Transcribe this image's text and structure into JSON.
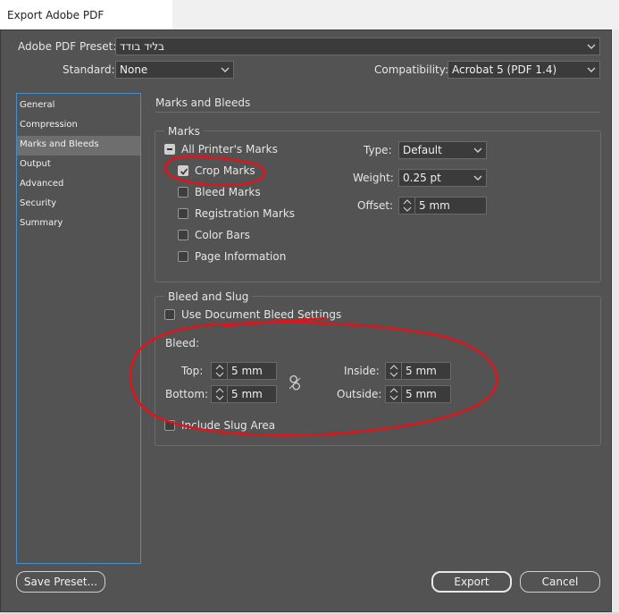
{
  "window": {
    "title": "Export Adobe PDF"
  },
  "preset": {
    "label": "Adobe PDF Preset:",
    "value": "בליד בודד"
  },
  "standard": {
    "label": "Standard:",
    "value": "None"
  },
  "compatibility": {
    "label": "Compatibility:",
    "value": "Acrobat 5 (PDF 1.4)"
  },
  "sidebar": {
    "items": [
      {
        "label": "General"
      },
      {
        "label": "Compression"
      },
      {
        "label": "Marks and Bleeds"
      },
      {
        "label": "Output"
      },
      {
        "label": "Advanced"
      },
      {
        "label": "Security"
      },
      {
        "label": "Summary"
      }
    ],
    "selected_index": 2
  },
  "panel": {
    "title": "Marks and Bleeds"
  },
  "marks": {
    "group_title": "Marks",
    "all_printers_marks": "All Printer's Marks",
    "crop_marks": "Crop Marks",
    "bleed_marks": "Bleed Marks",
    "registration_marks": "Registration Marks",
    "color_bars": "Color Bars",
    "page_information": "Page Information",
    "type_label": "Type:",
    "type_value": "Default",
    "weight_label": "Weight:",
    "weight_value": "0.25 pt",
    "offset_label": "Offset:",
    "offset_value": "5 mm"
  },
  "bleed_slug": {
    "group_title": "Bleed and Slug",
    "use_document_bleed": "Use Document Bleed Settings",
    "bleed_label": "Bleed:",
    "top_label": "Top:",
    "top_value": "5 mm",
    "bottom_label": "Bottom:",
    "bottom_value": "5 mm",
    "inside_label": "Inside:",
    "inside_value": "5 mm",
    "outside_label": "Outside:",
    "outside_value": "5 mm",
    "include_slug": "Include Slug Area"
  },
  "buttons": {
    "save_preset": "Save Preset...",
    "export": "Export",
    "cancel": "Cancel"
  },
  "colors": {
    "dialog_bg": "#535353",
    "field_bg": "#3b3b3b",
    "selection": "#6e6e6e",
    "focus_border": "#4a90c8",
    "annotation": "#e0141c"
  },
  "annotations": {
    "type": "red freehand circles around Crop Marks and Bleed settings"
  }
}
